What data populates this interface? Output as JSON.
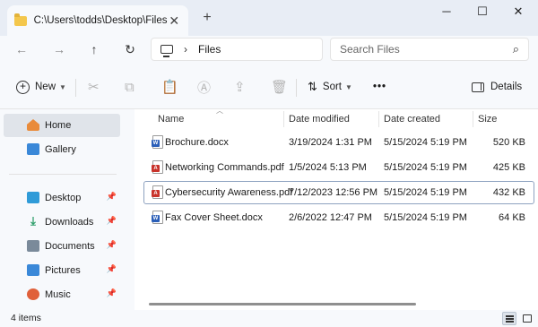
{
  "tab": {
    "title": "C:\\Users\\todds\\Desktop\\Files",
    "close": "✕",
    "new_tab": "+"
  },
  "window": {
    "minimize": "─",
    "maximize": "☐",
    "close": "✕"
  },
  "nav": {
    "back": "←",
    "forward": "→",
    "up": "↑",
    "refresh": "↻"
  },
  "address": {
    "separator": "›",
    "crumb": "Files"
  },
  "search": {
    "placeholder": "Search Files",
    "value": ""
  },
  "toolbar": {
    "new_label": "New",
    "sort_label": "Sort",
    "more": "•••",
    "details_label": "Details",
    "disabled_icons": [
      "cut-icon",
      "copy-icon",
      "paste-icon",
      "rename-icon",
      "share-icon",
      "delete-icon"
    ]
  },
  "sidebar": {
    "items": [
      {
        "label": "Home",
        "icon": "home-icon",
        "color": "#e98b3b",
        "pinned": false
      },
      {
        "label": "Gallery",
        "icon": "gallery-icon",
        "color": "#3a88d8",
        "pinned": false
      },
      {
        "label": "Desktop",
        "icon": "desktop-icon",
        "color": "#2f9bd8",
        "pinned": true
      },
      {
        "label": "Downloads",
        "icon": "downloads-icon",
        "color": "#2e9e6a",
        "pinned": true
      },
      {
        "label": "Documents",
        "icon": "documents-icon",
        "color": "#7a8a9a",
        "pinned": true
      },
      {
        "label": "Pictures",
        "icon": "pictures-icon",
        "color": "#3a88d8",
        "pinned": true
      },
      {
        "label": "Music",
        "icon": "music-icon",
        "color": "#e0603a",
        "pinned": true
      }
    ],
    "pin_glyph": "📌"
  },
  "columns": {
    "name": "Name",
    "modified": "Date modified",
    "created": "Date created",
    "size": "Size"
  },
  "files": [
    {
      "name": "Brochure.docx",
      "modified": "3/19/2024 1:31 PM",
      "created": "5/15/2024 5:19 PM",
      "size": "520 KB",
      "type": "docx",
      "badge": "W",
      "badge_color": "#2b5fb8"
    },
    {
      "name": "Networking Commands.pdf",
      "modified": "1/5/2024 5:13 PM",
      "created": "5/15/2024 5:19 PM",
      "size": "425 KB",
      "type": "pdf",
      "badge": "A",
      "badge_color": "#c8332b"
    },
    {
      "name": "Cybersecurity Awareness.pdf",
      "modified": "7/12/2023 12:56 PM",
      "created": "5/15/2024 5:19 PM",
      "size": "432 KB",
      "type": "pdf",
      "badge": "A",
      "badge_color": "#c8332b"
    },
    {
      "name": "Fax Cover Sheet.docx",
      "modified": "2/6/2022 12:47 PM",
      "created": "5/15/2024 5:19 PM",
      "size": "64 KB",
      "type": "docx",
      "badge": "W",
      "badge_color": "#2b5fb8"
    }
  ],
  "status": {
    "item_count": "4 items"
  }
}
